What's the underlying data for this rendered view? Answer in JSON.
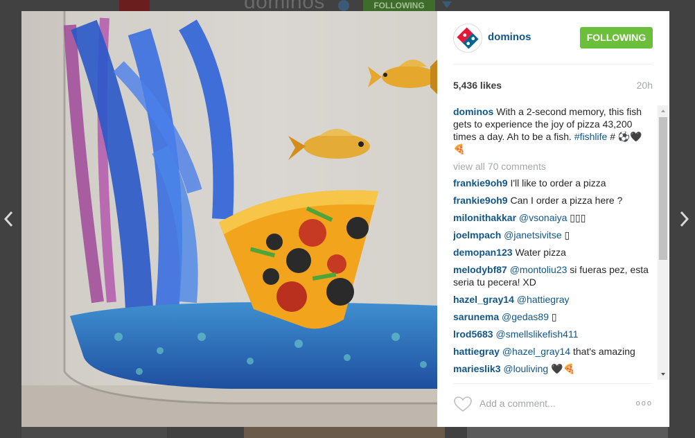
{
  "background_page": {
    "title": "dominos",
    "follow_label": "FOLLOWING"
  },
  "post": {
    "username": "dominos",
    "follow_button": "FOLLOWING",
    "likes": "5,436 likes",
    "time": "20h",
    "caption": {
      "username": "dominos",
      "text": "With a 2-second memory, this fish gets to experience the joy of pizza 43,200 times a day. Ah to be a fish.",
      "hashtag": "#fishlife",
      "tail": " # ⚽🖤🍕"
    },
    "view_all_comments": "view all 70 comments",
    "comments": [
      {
        "user": "frankie9oh9",
        "mention": "",
        "text": "I'll like to order a pizza"
      },
      {
        "user": "frankie9oh9",
        "mention": "",
        "text": "Can I order a pizza here ?"
      },
      {
        "user": "milonithakkar",
        "mention": "@vsonaiya",
        "text": "▯▯▯"
      },
      {
        "user": "joelmpach",
        "mention": "@janetsivitse",
        "text": "▯"
      },
      {
        "user": "demopan123",
        "mention": "",
        "text": "Water pizza"
      },
      {
        "user": "melodybf87",
        "mention": "@montoliu23",
        "text": "si fueras pez, esta seria tu pecera! XD"
      },
      {
        "user": "hazel_gray14",
        "mention": "@hattiegray",
        "text": ""
      },
      {
        "user": "sarunema",
        "mention": "@gedas89",
        "text": "▯"
      },
      {
        "user": "lrod5683",
        "mention": "@smellslikefish411",
        "text": ""
      },
      {
        "user": "hattiegray",
        "mention": "@hazel_gray14",
        "text": "that's amazing"
      },
      {
        "user": "marieslik3",
        "mention": "@louliving",
        "text": "🖤🍕"
      }
    ],
    "add_comment_placeholder": "Add a comment...",
    "more_icon": "ooo"
  },
  "icons": {
    "prev": "chevron-left-icon",
    "next": "chevron-right-icon",
    "like": "heart-icon"
  },
  "colors": {
    "follow_green": "#6bbf3a",
    "link_blue": "#125688",
    "muted": "#a5a7aa"
  }
}
